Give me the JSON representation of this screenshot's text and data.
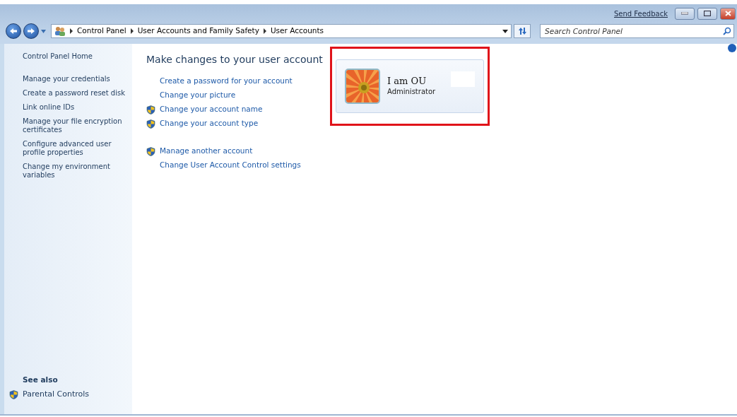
{
  "title_bar": {
    "feedback_link": "Send Feedback"
  },
  "address_bar": {
    "crumbs": [
      "Control Panel",
      "User Accounts and Family Safety",
      "User Accounts"
    ]
  },
  "search": {
    "placeholder": "Search Control Panel"
  },
  "sidebar": {
    "home": "Control Panel Home",
    "items": [
      {
        "label": "Manage your credentials"
      },
      {
        "label": "Create a password reset disk"
      },
      {
        "label": "Link online IDs"
      },
      {
        "label": "Manage your file encryption certificates"
      },
      {
        "label": "Configure advanced user profile properties"
      },
      {
        "label": "Change my environment variables"
      }
    ],
    "see_also": {
      "heading": "See also",
      "items": [
        {
          "label": "Parental Controls",
          "shield": true
        }
      ]
    }
  },
  "main": {
    "heading": "Make changes to your user account",
    "groups": [
      [
        {
          "label": "Create a password for your account",
          "shield": false
        },
        {
          "label": "Change your picture",
          "shield": false
        },
        {
          "label": "Change your account name",
          "shield": true
        },
        {
          "label": "Change your account type",
          "shield": true
        }
      ],
      [
        {
          "label": "Manage another account",
          "shield": true
        },
        {
          "label": "Change User Account Control settings",
          "shield": false
        }
      ]
    ],
    "account": {
      "name": "I am OU",
      "role": "Administrator",
      "highlighted": true,
      "redacted": true
    }
  }
}
